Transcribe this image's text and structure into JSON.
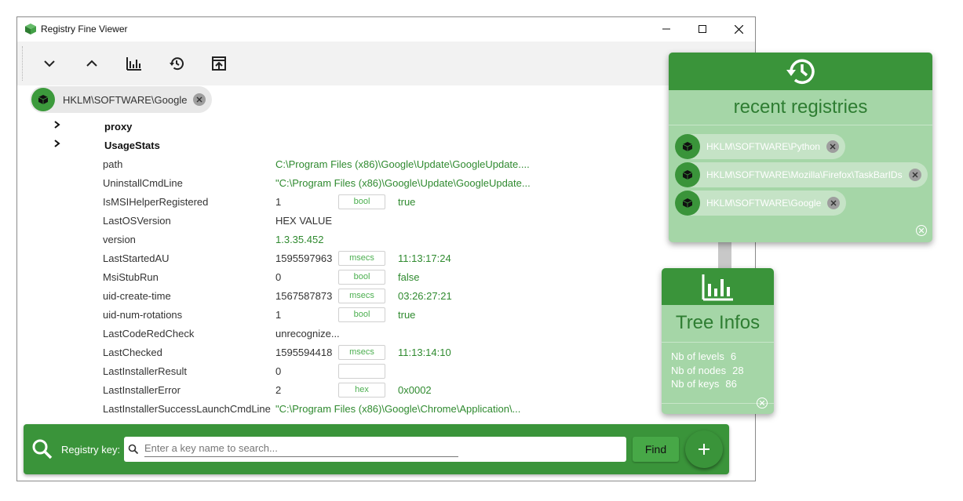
{
  "window": {
    "title": "Registry Fine Viewer"
  },
  "toolbar": {
    "buttons": [
      "collapse-all",
      "expand-all",
      "tree-infos",
      "history",
      "export"
    ]
  },
  "breadcrumb": {
    "path": "HKLM\\SOFTWARE\\Google"
  },
  "tree": {
    "folders": [
      {
        "name": "proxy"
      },
      {
        "name": "UsageStats"
      }
    ],
    "values": [
      {
        "name": "path",
        "value": "C:\\Program Files (x86)\\Google\\Update\\GoogleUpdate....",
        "green": true,
        "badge": null,
        "converted": ""
      },
      {
        "name": "UninstallCmdLine",
        "value": "\"C:\\Program Files (x86)\\Google\\Update\\GoogleUpdate...",
        "green": true,
        "badge": null,
        "converted": ""
      },
      {
        "name": "IsMSIHelperRegistered",
        "value": "1",
        "green": false,
        "badge": "bool",
        "converted": "true"
      },
      {
        "name": "LastOSVersion",
        "value": "HEX VALUE",
        "green": false,
        "badge": null,
        "converted": ""
      },
      {
        "name": "version",
        "value": "1.3.35.452",
        "green": true,
        "badge": null,
        "converted": ""
      },
      {
        "name": "LastStartedAU",
        "value": "1595597963",
        "green": false,
        "badge": "msecs",
        "converted": "11:13:17:24"
      },
      {
        "name": "MsiStubRun",
        "value": "0",
        "green": false,
        "badge": "bool",
        "converted": "false"
      },
      {
        "name": "uid-create-time",
        "value": "1567587873",
        "green": false,
        "badge": "msecs",
        "converted": "03:26:27:21"
      },
      {
        "name": "uid-num-rotations",
        "value": "1",
        "green": false,
        "badge": "bool",
        "converted": "true"
      },
      {
        "name": "LastCodeRedCheck",
        "value": "unrecognize...",
        "green": false,
        "badge": null,
        "converted": ""
      },
      {
        "name": "LastChecked",
        "value": "1595594418",
        "green": false,
        "badge": "msecs",
        "converted": "11:13:14:10"
      },
      {
        "name": "LastInstallerResult",
        "value": "0",
        "green": false,
        "badge": "",
        "converted": ""
      },
      {
        "name": "LastInstallerError",
        "value": "2",
        "green": false,
        "badge": "hex",
        "converted": "0x0002"
      },
      {
        "name": "LastInstallerSuccessLaunchCmdLine",
        "value": "\"C:\\Program Files (x86)\\Google\\Chrome\\Application\\...",
        "green": true,
        "badge": null,
        "converted": ""
      }
    ]
  },
  "search": {
    "label": "Registry key:",
    "placeholder": "Enter a key name to search...",
    "find_label": "Find"
  },
  "recent": {
    "title": "recent registries",
    "items": [
      "HKLM\\SOFTWARE\\Python",
      "HKLM\\SOFTWARE\\Mozilla\\Firefox\\TaskBarIDs",
      "HKLM\\SOFTWARE\\Google"
    ]
  },
  "tree_infos": {
    "title": "Tree Infos",
    "levels_label": "Nb of levels",
    "levels": "6",
    "nodes_label": "Nb of nodes",
    "nodes": "28",
    "keys_label": "Nb of keys",
    "keys": "86"
  },
  "colors": {
    "primary": "#3a943a",
    "panel": "#a5d6a7",
    "value_green": "#2f8a2f"
  }
}
